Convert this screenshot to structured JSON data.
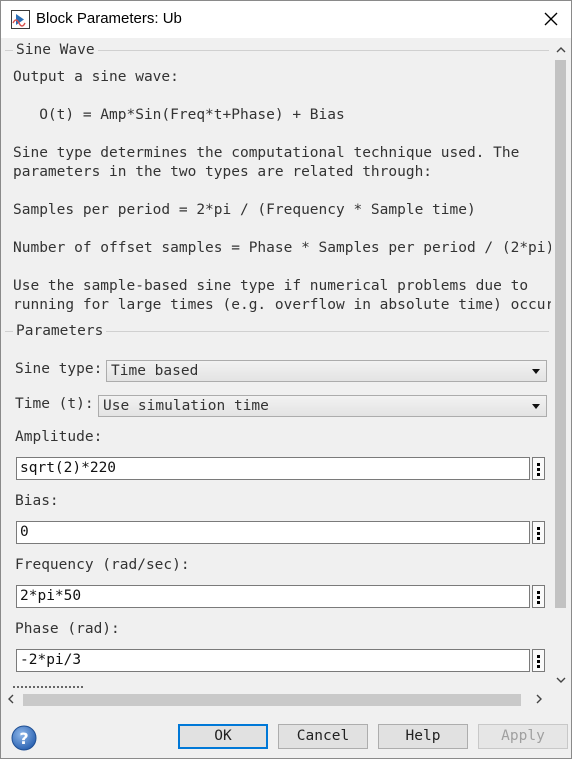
{
  "window": {
    "title": "Block Parameters: Ub"
  },
  "sine_wave_group": {
    "title": "Sine Wave",
    "description": [
      "Output a sine wave:",
      "   O(t) = Amp*Sin(Freq*t+Phase) + Bias",
      "Sine type determines the computational technique used. The",
      "parameters in the two types are related through:",
      "Samples per period = 2*pi / (Frequency * Sample time)",
      "Number of offset samples = Phase * Samples per period / (2*pi)",
      "Use the sample-based sine type if numerical problems due to",
      "running for large times (e.g. overflow in absolute time) occur."
    ]
  },
  "parameters_group": {
    "title": "Parameters",
    "sine_type": {
      "label": "Sine type:",
      "value": "Time based"
    },
    "time": {
      "label": "Time (t):",
      "value": "Use simulation time"
    },
    "amplitude": {
      "label": "Amplitude:",
      "value": "sqrt(2)*220"
    },
    "bias": {
      "label": "Bias:",
      "value": "0"
    },
    "frequency": {
      "label": "Frequency (rad/sec):",
      "value": "2*pi*50"
    },
    "phase": {
      "label": "Phase (rad):",
      "value": "-2*pi/3"
    }
  },
  "buttons": {
    "ok": "OK",
    "cancel": "Cancel",
    "help": "Help",
    "apply": "Apply"
  },
  "icons": {
    "app": "simulink-block-icon",
    "close": "close-icon",
    "help": "help-question-icon",
    "param_menu": "more-vertical-icon"
  },
  "colors": {
    "default_button_border": "#0078d7",
    "dialog_background": "#f0f0f0"
  }
}
